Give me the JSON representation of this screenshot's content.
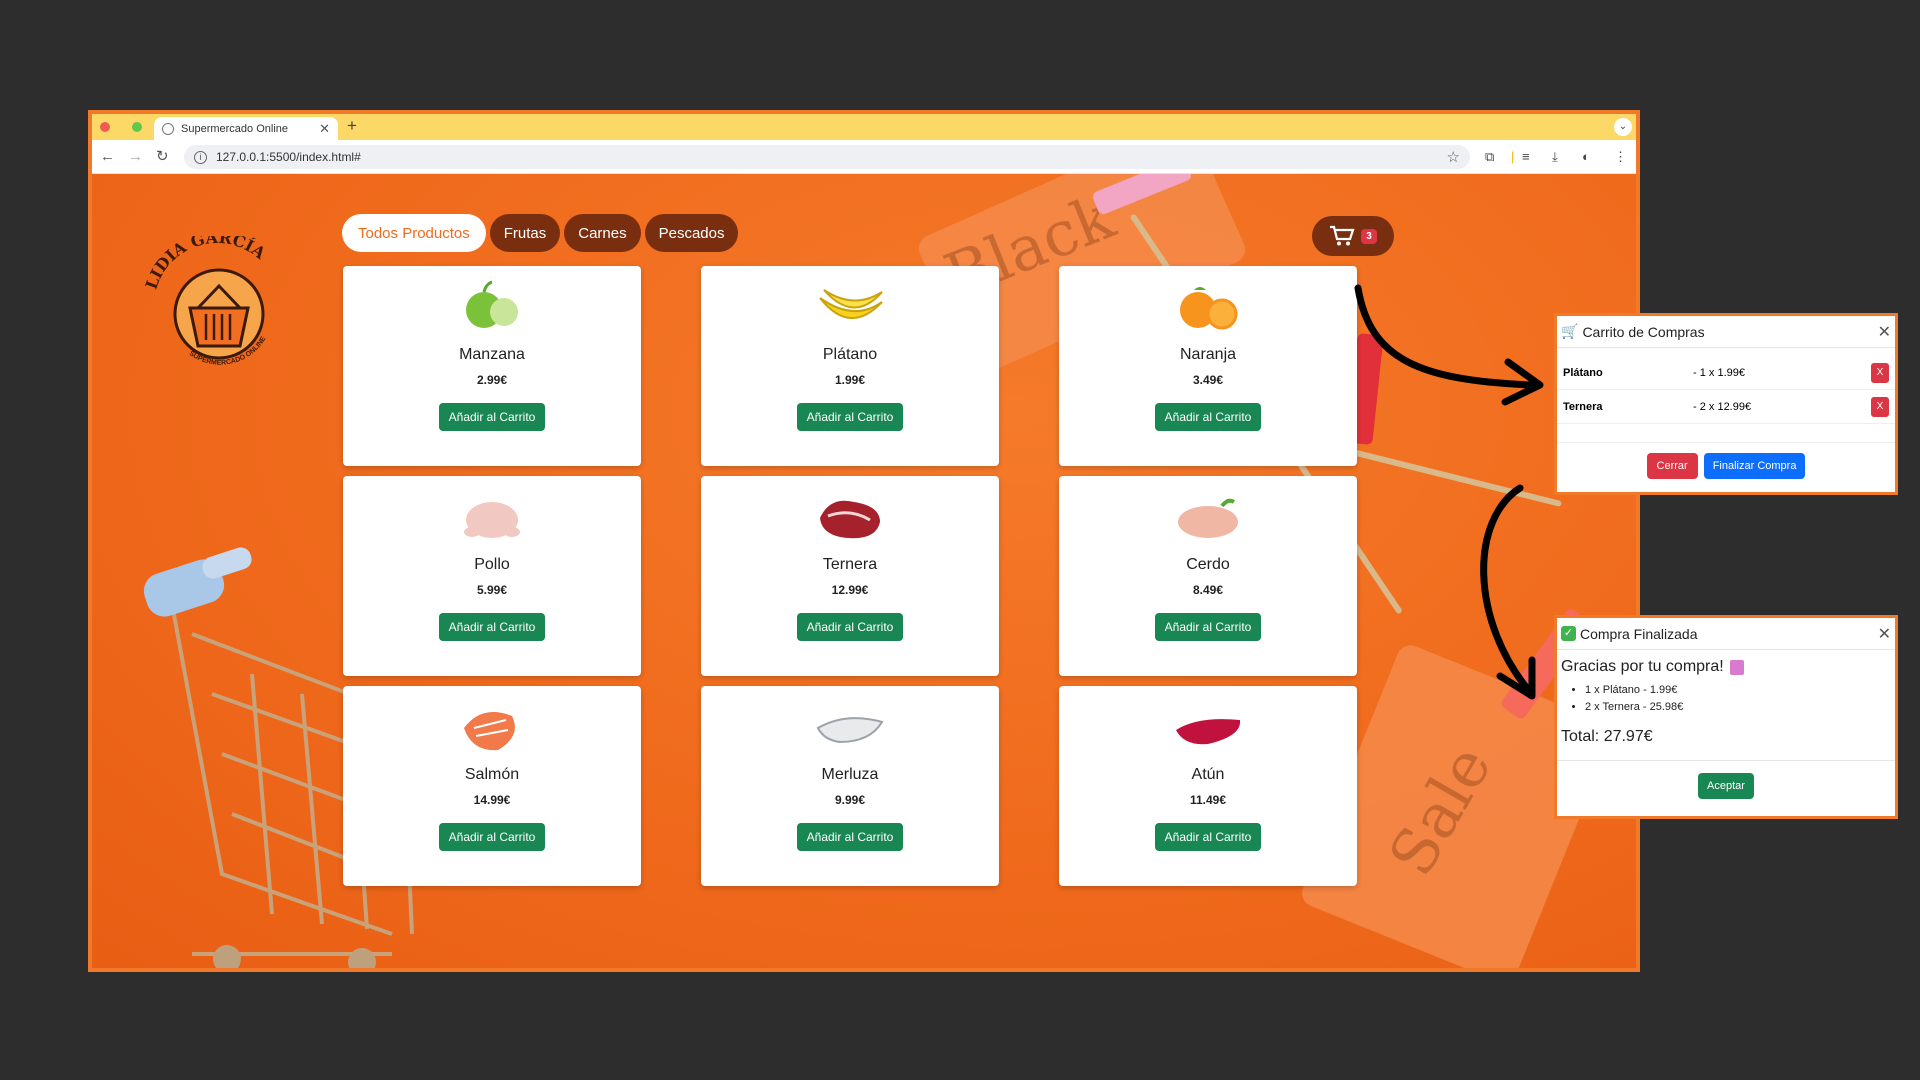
{
  "browser": {
    "tab_title": "Supermercado Online",
    "url": "127.0.0.1:5500/index.html#"
  },
  "logo": {
    "top_text": "LIDIA GARCÍA",
    "bottom_text": "SUPERMERCADO ONLINE"
  },
  "categories": [
    "Todos Productos",
    "Frutas",
    "Carnes",
    "Pescados"
  ],
  "active_category": "Todos Productos",
  "cart": {
    "count": "3"
  },
  "background_words": [
    "Black",
    "Sale"
  ],
  "products": [
    {
      "name": "Manzana",
      "price": "2.99€",
      "icon": "apple-icon"
    },
    {
      "name": "Plátano",
      "price": "1.99€",
      "icon": "banana-icon"
    },
    {
      "name": "Naranja",
      "price": "3.49€",
      "icon": "orange-icon"
    },
    {
      "name": "Pollo",
      "price": "5.99€",
      "icon": "chicken-icon"
    },
    {
      "name": "Ternera",
      "price": "12.99€",
      "icon": "beef-icon"
    },
    {
      "name": "Cerdo",
      "price": "8.49€",
      "icon": "pork-icon"
    },
    {
      "name": "Salmón",
      "price": "14.99€",
      "icon": "salmon-icon"
    },
    {
      "name": "Merluza",
      "price": "9.99€",
      "icon": "hake-icon"
    },
    {
      "name": "Atún",
      "price": "11.49€",
      "icon": "tuna-icon"
    }
  ],
  "add_label": "Añadir al Carrito",
  "cart_modal": {
    "title": "Carrito de Compras",
    "items": [
      {
        "name": "Plátano",
        "detail": "- 1 x 1.99€",
        "remove": "X"
      },
      {
        "name": "Ternera",
        "detail": "- 2 x 12.99€",
        "remove": "X"
      }
    ],
    "close_label": "Cerrar",
    "checkout_label": "Finalizar Compra"
  },
  "done_modal": {
    "title": "Compra Finalizada",
    "message": "Gracias por tu compra!",
    "lines": [
      "1 x Plátano - 1.99€",
      "2 x Ternera - 25.98€"
    ],
    "total": "Total: 27.97€",
    "accept_label": "Aceptar"
  },
  "colors": {
    "accent": "#f06a1c",
    "dark_pill": "#7a2e10",
    "add_button": "#198754",
    "danger": "#dc3545",
    "primary": "#0d6efd"
  }
}
